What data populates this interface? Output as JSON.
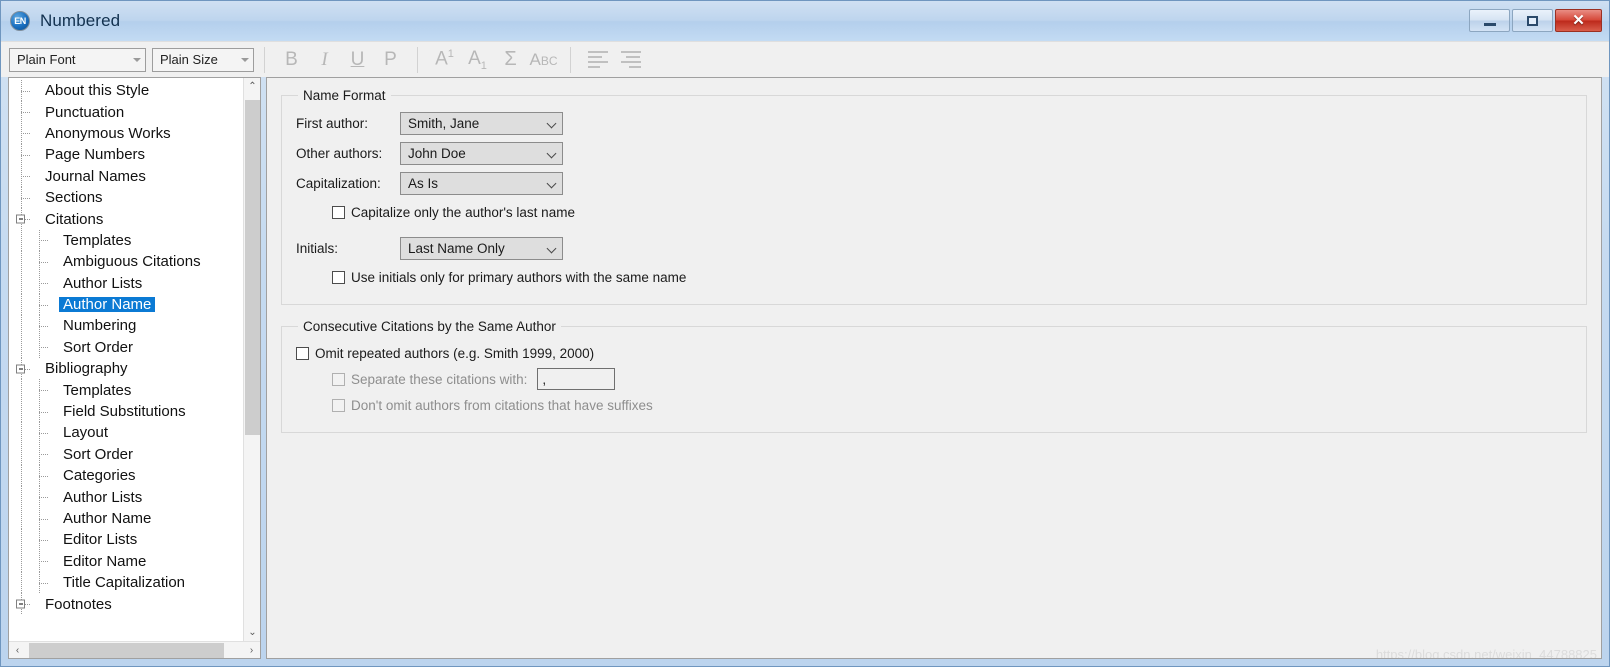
{
  "window": {
    "title": "Numbered",
    "app_icon": "endnote-en-icon",
    "controls": {
      "minimize": "minimize-button",
      "maximize": "maximize-button",
      "close": "close-button"
    }
  },
  "toolbar": {
    "font_combo": {
      "value": "Plain Font"
    },
    "size_combo": {
      "value": "Plain Size"
    },
    "buttons": [
      {
        "name": "bold-button",
        "label": "B"
      },
      {
        "name": "italic-button",
        "label": "I"
      },
      {
        "name": "underline-button",
        "label": "U"
      },
      {
        "name": "plain-button",
        "label": "P"
      }
    ],
    "script_buttons": [
      {
        "name": "superscript-button",
        "base": "A",
        "mark": "1"
      },
      {
        "name": "subscript-button",
        "base": "A",
        "mark": "1"
      },
      {
        "name": "sigma-button",
        "label": "Σ"
      },
      {
        "name": "small-caps-button",
        "base": "A",
        "rest": "BC"
      }
    ],
    "align_buttons": [
      {
        "name": "align-left-button"
      },
      {
        "name": "align-right-button"
      }
    ]
  },
  "tree": {
    "items": [
      {
        "label": "About this Style",
        "level": 1,
        "expander": false,
        "selected": false
      },
      {
        "label": "Punctuation",
        "level": 1,
        "expander": false,
        "selected": false
      },
      {
        "label": "Anonymous Works",
        "level": 1,
        "expander": false,
        "selected": false
      },
      {
        "label": "Page Numbers",
        "level": 1,
        "expander": false,
        "selected": false
      },
      {
        "label": "Journal Names",
        "level": 1,
        "expander": false,
        "selected": false
      },
      {
        "label": "Sections",
        "level": 1,
        "expander": false,
        "selected": false
      },
      {
        "label": "Citations",
        "level": 1,
        "expander": true,
        "selected": false
      },
      {
        "label": "Templates",
        "level": 2,
        "expander": false,
        "selected": false
      },
      {
        "label": "Ambiguous Citations",
        "level": 2,
        "expander": false,
        "selected": false
      },
      {
        "label": "Author Lists",
        "level": 2,
        "expander": false,
        "selected": false
      },
      {
        "label": "Author Name",
        "level": 2,
        "expander": false,
        "selected": true
      },
      {
        "label": "Numbering",
        "level": 2,
        "expander": false,
        "selected": false
      },
      {
        "label": "Sort Order",
        "level": 2,
        "expander": false,
        "selected": false
      },
      {
        "label": "Bibliography",
        "level": 1,
        "expander": true,
        "selected": false
      },
      {
        "label": "Templates",
        "level": 2,
        "expander": false,
        "selected": false
      },
      {
        "label": "Field Substitutions",
        "level": 2,
        "expander": false,
        "selected": false
      },
      {
        "label": "Layout",
        "level": 2,
        "expander": false,
        "selected": false
      },
      {
        "label": "Sort Order",
        "level": 2,
        "expander": false,
        "selected": false
      },
      {
        "label": "Categories",
        "level": 2,
        "expander": false,
        "selected": false
      },
      {
        "label": "Author Lists",
        "level": 2,
        "expander": false,
        "selected": false
      },
      {
        "label": "Author Name",
        "level": 2,
        "expander": false,
        "selected": false
      },
      {
        "label": "Editor Lists",
        "level": 2,
        "expander": false,
        "selected": false
      },
      {
        "label": "Editor Name",
        "level": 2,
        "expander": false,
        "selected": false
      },
      {
        "label": "Title Capitalization",
        "level": 2,
        "expander": false,
        "selected": false
      },
      {
        "label": "Footnotes",
        "level": 1,
        "expander": true,
        "selected": false
      }
    ],
    "scrollbars": {
      "up_arrow": "⌃",
      "down_arrow": "⌄",
      "left_arrow": "‹",
      "right_arrow": "›"
    }
  },
  "name_format": {
    "legend": "Name Format",
    "fields": [
      {
        "label": "First author:",
        "value": "Smith, Jane"
      },
      {
        "label": "Other authors:",
        "value": "John Doe"
      },
      {
        "label": "Capitalization:",
        "value": "As Is"
      }
    ],
    "capitalize_last_name": {
      "label": "Capitalize only the author's last name",
      "checked": false
    },
    "initials": {
      "label": "Initials:",
      "value": "Last Name Only"
    },
    "use_initials": {
      "label": "Use initials only for primary authors with the same name",
      "checked": false
    }
  },
  "consecutive": {
    "legend": "Consecutive Citations by the Same Author",
    "omit_repeated": {
      "label": "Omit repeated authors (e.g. Smith 1999, 2000)",
      "checked": false
    },
    "separator": {
      "label": "Separate these citations with:",
      "checked": false,
      "value": ","
    },
    "dont_omit_suffixes": {
      "label": "Don't omit authors from citations that have suffixes",
      "checked": false
    }
  },
  "watermark": "https://blog.csdn.net/weixin_44788825",
  "colors": {
    "selection": "#0b7ad4",
    "title_bar": "#bed5ee",
    "panel_bg": "#f0f0f0",
    "close_button": "#d6493a"
  }
}
